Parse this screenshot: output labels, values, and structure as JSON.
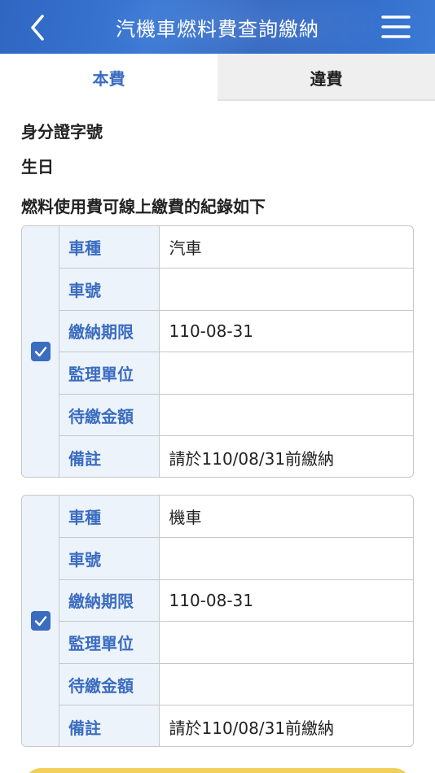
{
  "header": {
    "title": "汽機車燃料費查詢繳納",
    "back_icon": "chevron-left-icon",
    "menu_icon": "hamburger-menu-icon"
  },
  "tabs": [
    {
      "label": "本費",
      "active": true
    },
    {
      "label": "違費",
      "active": false
    }
  ],
  "info": {
    "id_label": "身分證字號",
    "birthday_label": "生日",
    "records_heading": "燃料使用費可線上繳費的紀錄如下"
  },
  "records": [
    {
      "checked": true,
      "rows": [
        {
          "key": "車種",
          "value": "汽車"
        },
        {
          "key": "車號",
          "value": ""
        },
        {
          "key": "繳納期限",
          "value": "110-08-31"
        },
        {
          "key": "監理單位",
          "value": ""
        },
        {
          "key": "待繳金額",
          "value": ""
        },
        {
          "key": "備註",
          "value": "請於110/08/31前繳納"
        }
      ]
    },
    {
      "checked": true,
      "rows": [
        {
          "key": "車種",
          "value": "機車"
        },
        {
          "key": "車號",
          "value": ""
        },
        {
          "key": "繳納期限",
          "value": "110-08-31"
        },
        {
          "key": "監理單位",
          "value": ""
        },
        {
          "key": "待繳金額",
          "value": ""
        },
        {
          "key": "備註",
          "value": "請於110/08/31前繳納"
        }
      ]
    }
  ],
  "colors": {
    "brand_blue": "#3a6cc0",
    "key_cell_bg": "#edf3fb",
    "button_yellow": "#f2cf5a"
  }
}
